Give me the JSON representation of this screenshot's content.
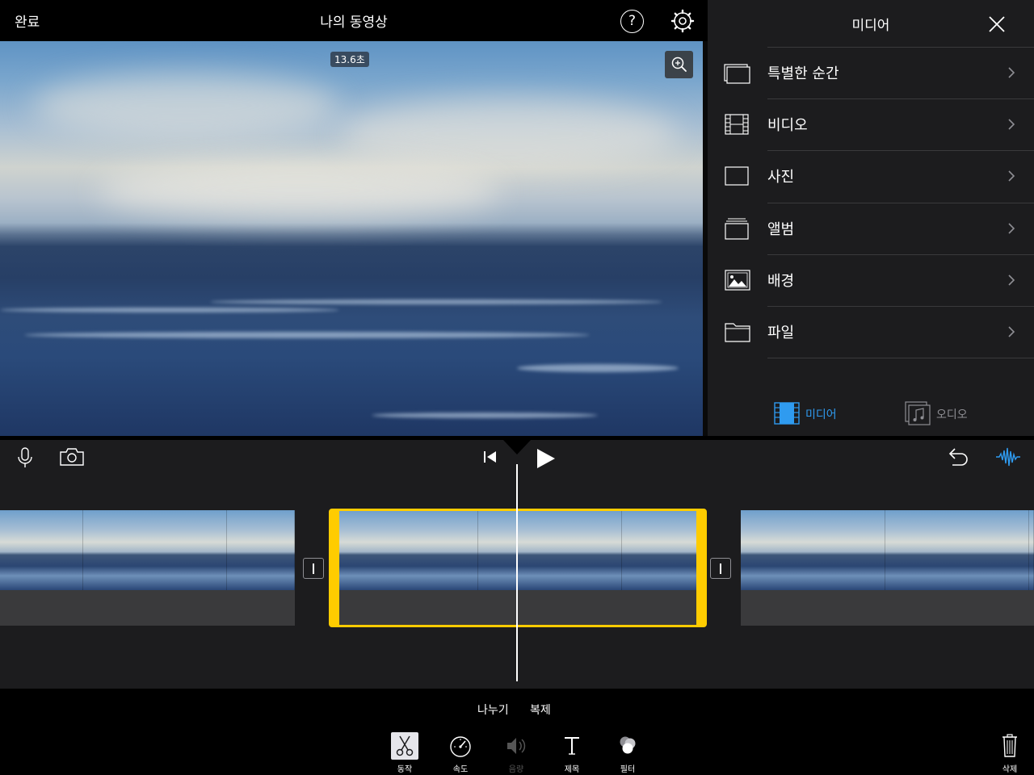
{
  "topbar": {
    "done_label": "완료",
    "project_title": "나의 동영상",
    "help_label": "?"
  },
  "preview": {
    "duration_badge": "13.6초"
  },
  "media_panel": {
    "title": "미디어",
    "items": [
      {
        "label": "특별한 순간",
        "icon": "moments-icon"
      },
      {
        "label": "비디오",
        "icon": "film-icon"
      },
      {
        "label": "사진",
        "icon": "photo-icon"
      },
      {
        "label": "앨범",
        "icon": "album-icon"
      },
      {
        "label": "배경",
        "icon": "landscape-icon"
      },
      {
        "label": "파일",
        "icon": "folder-icon"
      }
    ],
    "tabs": [
      {
        "label": "미디어",
        "active": true
      },
      {
        "label": "오디오",
        "active": false
      }
    ],
    "accent_color": "#2f9bf0"
  },
  "timeline": {
    "selected_clip_color": "#ffcc00"
  },
  "bottom": {
    "split_label": "나누기",
    "duplicate_label": "복제",
    "tools": [
      {
        "label": "동작",
        "icon": "scissors-icon",
        "active": true
      },
      {
        "label": "속도",
        "icon": "speedometer-icon",
        "active": false
      },
      {
        "label": "음량",
        "icon": "volume-icon",
        "active": false,
        "disabled": true
      },
      {
        "label": "제목",
        "icon": "title-icon",
        "active": false
      },
      {
        "label": "필터",
        "icon": "filter-icon",
        "active": false
      }
    ],
    "delete_label": "삭제"
  }
}
